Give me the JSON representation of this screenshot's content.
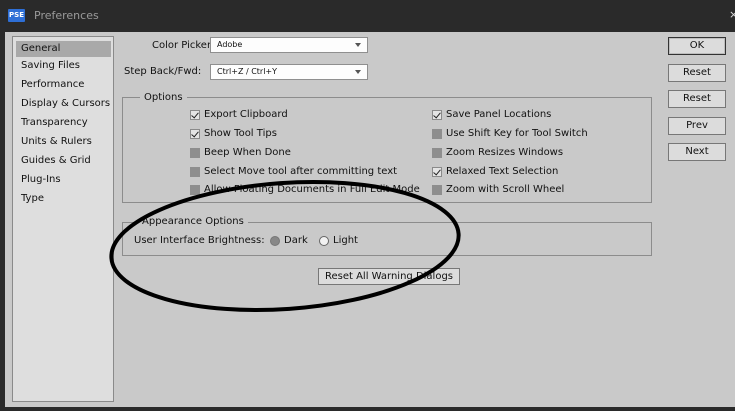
{
  "window": {
    "app_icon_text": "PSE",
    "title": "Preferences",
    "close_glyph": "×"
  },
  "sidebar": {
    "items": [
      {
        "label": "General",
        "selected": true
      },
      {
        "label": "Saving Files",
        "selected": false
      },
      {
        "label": "Performance",
        "selected": false
      },
      {
        "label": "Display & Cursors",
        "selected": false
      },
      {
        "label": "Transparency",
        "selected": false
      },
      {
        "label": "Units & Rulers",
        "selected": false
      },
      {
        "label": "Guides & Grid",
        "selected": false
      },
      {
        "label": "Plug-Ins",
        "selected": false
      },
      {
        "label": "Type",
        "selected": false
      }
    ]
  },
  "general": {
    "color_picker": {
      "label": "Color Picker:",
      "value": "Adobe"
    },
    "step_back_fwd": {
      "label": "Step Back/Fwd:",
      "value": "Ctrl+Z / Ctrl+Y"
    }
  },
  "options": {
    "title": "Options",
    "left": [
      {
        "label": "Export Clipboard",
        "checked": true
      },
      {
        "label": "Show Tool Tips",
        "checked": true
      },
      {
        "label": "Beep When Done",
        "checked": false
      },
      {
        "label": "Select Move tool after committing text",
        "checked": false
      },
      {
        "label": "Allow Floating Documents in Full Edit Mode",
        "checked": false
      }
    ],
    "right": [
      {
        "label": "Save Panel Locations",
        "checked": true
      },
      {
        "label": "Use Shift Key for Tool Switch",
        "checked": false
      },
      {
        "label": "Zoom Resizes Windows",
        "checked": false
      },
      {
        "label": "Relaxed Text Selection",
        "checked": true
      },
      {
        "label": "Zoom with Scroll Wheel",
        "checked": false
      }
    ]
  },
  "appearance": {
    "title": "Appearance Options",
    "brightness_label": "User Interface Brightness:",
    "dark_label": "Dark",
    "light_label": "Light",
    "selected": "Dark"
  },
  "reset_warning_label": "Reset All Warning Dialogs",
  "buttons": {
    "ok": "OK",
    "cancel": "Reset",
    "reset": "Reset",
    "prev": "Prev",
    "next": "Next"
  },
  "annotation": {
    "shape": "ellipse",
    "stroke": "#000000"
  }
}
